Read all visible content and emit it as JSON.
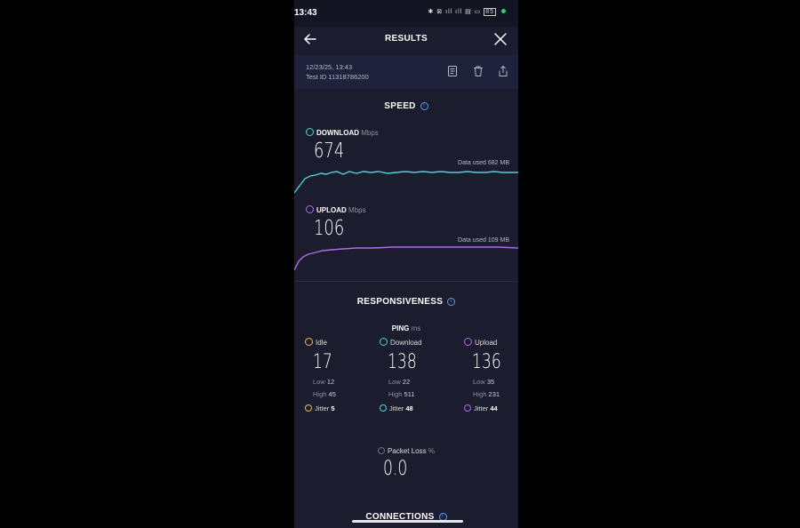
{
  "status": {
    "time": "13:43",
    "icons": "✱ ⊠ ıll ıll ▤ ▭",
    "battery": "85"
  },
  "header": {
    "title": "RESULTS"
  },
  "meta": {
    "date": "12/23/25, 13:43",
    "test_id": "Test ID 11318786200"
  },
  "speed": {
    "title": "SPEED",
    "download": {
      "label": "DOWNLOAD",
      "unit": "Mbps",
      "value": "674",
      "data_used": "Data used 682 MB",
      "color": "#4fd1d9"
    },
    "upload": {
      "label": "UPLOAD",
      "unit": "Mbps",
      "value": "106",
      "data_used": "Data used 109 MB",
      "color": "#b06ae8"
    }
  },
  "responsiveness": {
    "title": "RESPONSIVENESS",
    "ping_label": "PING",
    "ping_unit": "ms",
    "idle": {
      "label": "Idle",
      "value": "17",
      "low_label": "Low",
      "low": "12",
      "high_label": "High",
      "high": "45",
      "jitter_label": "Jitter",
      "jitter": "5",
      "color": "#e6c14a"
    },
    "download": {
      "label": "Download",
      "value": "138",
      "low_label": "Low",
      "low": "22",
      "high_label": "High",
      "high": "511",
      "jitter_label": "Jitter",
      "jitter": "48",
      "color": "#4fd1d9"
    },
    "upload": {
      "label": "Upload",
      "value": "136",
      "low_label": "Low",
      "low": "35",
      "high_label": "High",
      "high": "231",
      "jitter_label": "Jitter",
      "jitter": "44",
      "color": "#b06ae8"
    }
  },
  "packet_loss": {
    "label": "Packet Loss",
    "unit": "%",
    "value": "0.0"
  },
  "next_section": {
    "title": "CONNECTIONS"
  }
}
